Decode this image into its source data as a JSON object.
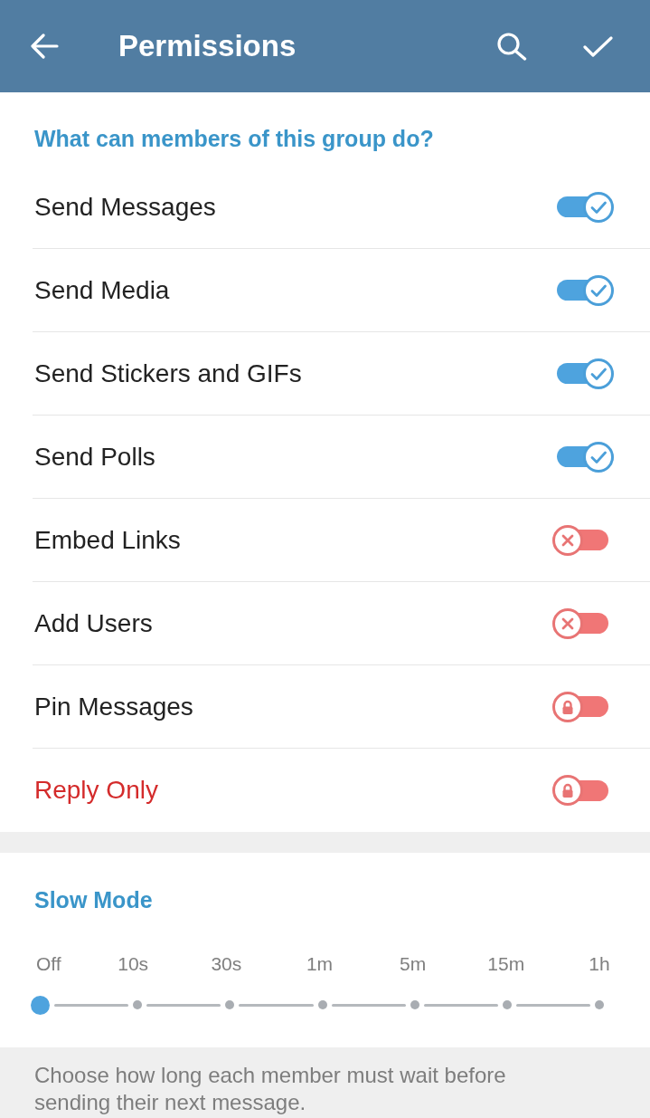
{
  "app_bar": {
    "title": "Permissions"
  },
  "permissions_section": {
    "title": "What can members of this group do?",
    "items": [
      {
        "label": "Send Messages",
        "on": true,
        "locked": false,
        "color": "#222222"
      },
      {
        "label": "Send Media",
        "on": true,
        "locked": false,
        "color": "#222222"
      },
      {
        "label": "Send Stickers and GIFs",
        "on": true,
        "locked": false,
        "color": "#222222"
      },
      {
        "label": "Send Polls",
        "on": true,
        "locked": false,
        "color": "#222222"
      },
      {
        "label": "Embed Links",
        "on": false,
        "locked": false,
        "color": "#222222"
      },
      {
        "label": "Add Users",
        "on": false,
        "locked": false,
        "color": "#222222"
      },
      {
        "label": "Pin Messages",
        "on": false,
        "locked": true,
        "color": "#222222"
      },
      {
        "label": "Reply Only",
        "on": false,
        "locked": true,
        "color": "#d42b2b"
      }
    ]
  },
  "slow_mode": {
    "title": "Slow Mode",
    "options": [
      {
        "label": "Off",
        "selected": true
      },
      {
        "label": "10s",
        "selected": false
      },
      {
        "label": "30s",
        "selected": false
      },
      {
        "label": "1m",
        "selected": false
      },
      {
        "label": "5m",
        "selected": false
      },
      {
        "label": "15m",
        "selected": false
      },
      {
        "label": "1h",
        "selected": false
      }
    ]
  },
  "note": {
    "text": "Choose how long each member must wait before sending their next message."
  }
}
